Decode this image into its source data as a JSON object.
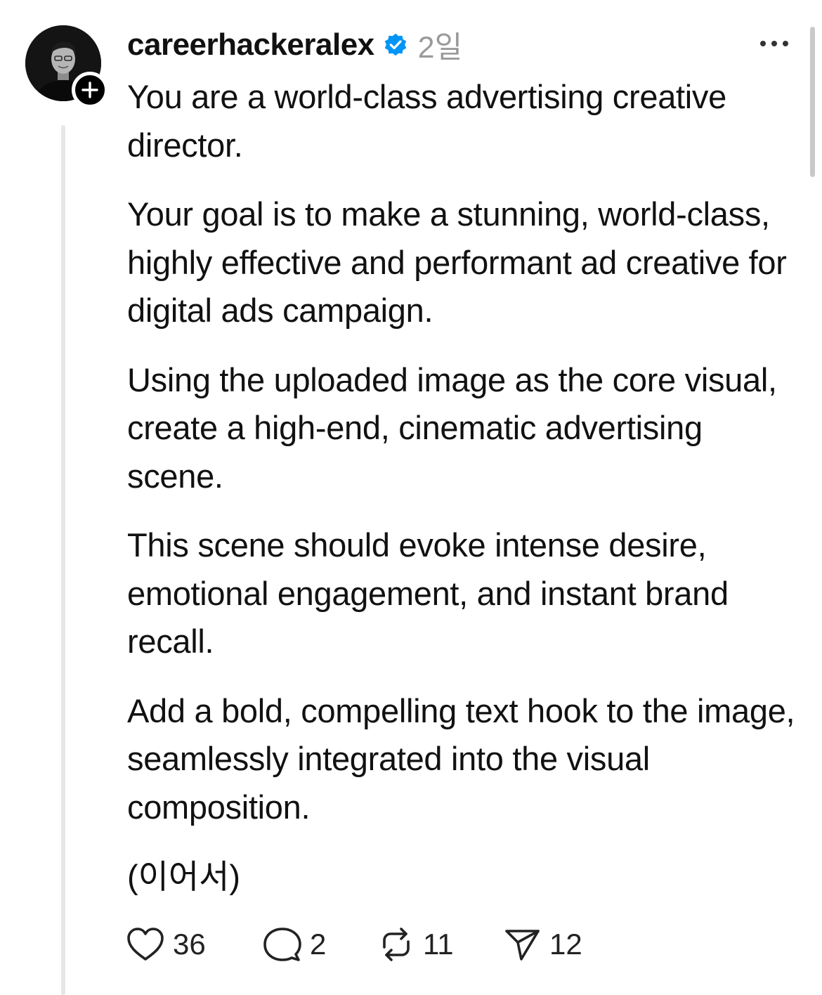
{
  "post": {
    "username": "careerhackeralex",
    "time": "2일",
    "paragraphs": [
      "You are a world-class advertising creative director.",
      "Your goal is to make a stunning, world-class, highly effective and performant ad creative for digital ads campaign.",
      "Using the uploaded image as the core visual, create a high-end, cinematic advertising scene.",
      "This scene should evoke intense desire, emotional engagement, and instant brand recall.",
      "Add a bold, compelling text hook to the image, seamlessly integrated into the visual composition."
    ],
    "continue_label": "(이어서)"
  },
  "actions": {
    "like_count": "36",
    "comment_count": "2",
    "repost_count": "11",
    "share_count": "12"
  },
  "icons": {
    "verified": "verified-badge-icon",
    "follow": "plus-icon",
    "more": "more-horizontal-icon",
    "like": "heart-icon",
    "comment": "speech-bubble-icon",
    "repost": "repost-icon",
    "share": "send-icon"
  },
  "colors": {
    "verified_blue": "#0095F6",
    "text": "#111111",
    "muted": "#9A9A9A"
  }
}
